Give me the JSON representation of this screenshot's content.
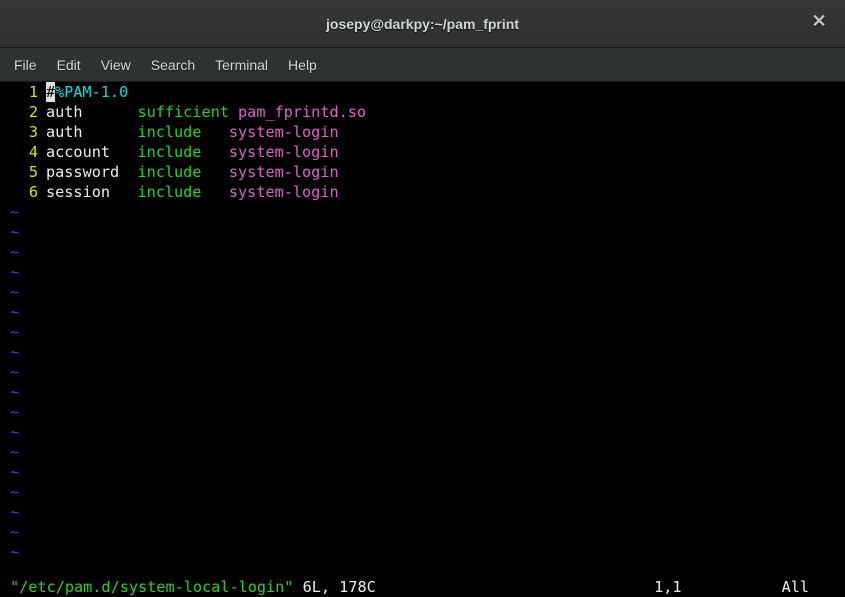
{
  "title": "josepy@darkpy:~/pam_fprint",
  "menu": [
    "File",
    "Edit",
    "View",
    "Search",
    "Terminal",
    "Help"
  ],
  "lines": [
    {
      "n": "1",
      "segments": [
        {
          "cls": "cursor",
          "t": "#"
        },
        {
          "cls": "c-cyan",
          "t": "%PAM-1.0"
        }
      ]
    },
    {
      "n": "2",
      "segments": [
        {
          "cls": "c-white",
          "t": "auth      "
        },
        {
          "cls": "c-green",
          "t": "sufficient"
        },
        {
          "cls": "c-white",
          "t": " "
        },
        {
          "cls": "c-magenta",
          "t": "pam_fprintd.so"
        }
      ]
    },
    {
      "n": "3",
      "segments": [
        {
          "cls": "c-white",
          "t": "auth      "
        },
        {
          "cls": "c-green",
          "t": "include"
        },
        {
          "cls": "c-white",
          "t": "   "
        },
        {
          "cls": "c-magenta",
          "t": "system-login"
        }
      ]
    },
    {
      "n": "4",
      "segments": [
        {
          "cls": "c-white",
          "t": "account   "
        },
        {
          "cls": "c-green",
          "t": "include"
        },
        {
          "cls": "c-white",
          "t": "   "
        },
        {
          "cls": "c-magenta",
          "t": "system-login"
        }
      ]
    },
    {
      "n": "5",
      "segments": [
        {
          "cls": "c-white",
          "t": "password  "
        },
        {
          "cls": "c-green",
          "t": "include"
        },
        {
          "cls": "c-white",
          "t": "   "
        },
        {
          "cls": "c-magenta",
          "t": "system-login"
        }
      ]
    },
    {
      "n": "6",
      "segments": [
        {
          "cls": "c-white",
          "t": "session   "
        },
        {
          "cls": "c-green",
          "t": "include"
        },
        {
          "cls": "c-white",
          "t": "   "
        },
        {
          "cls": "c-magenta",
          "t": "system-login"
        }
      ]
    }
  ],
  "tilde_count": 18,
  "tilde": "~",
  "status": {
    "file": "\"/etc/pam.d/system-local-login\"",
    "info": " 6L, 178C",
    "pos": "1,1",
    "all": "All"
  },
  "close": "✕"
}
